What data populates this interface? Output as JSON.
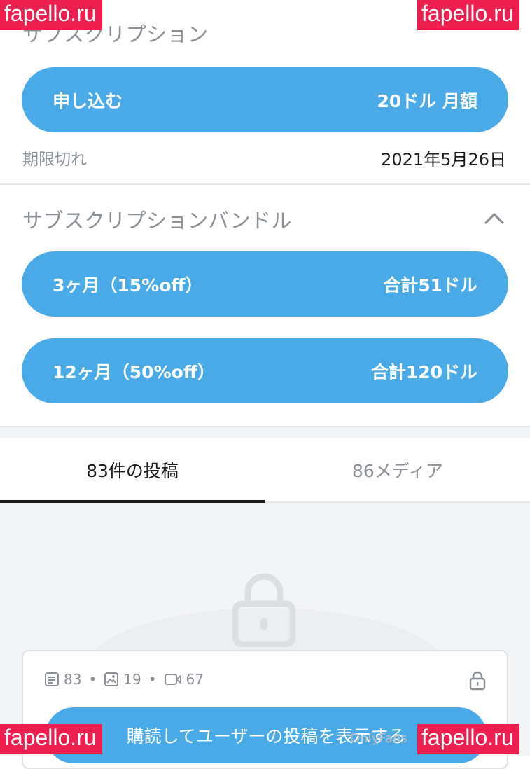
{
  "subscription": {
    "title": "サブスクリプション",
    "subscribe_label": "申し込む",
    "price_label": "20ドル 月額",
    "expiry_label": "期限切れ",
    "expiry_date": "2021年5月26日"
  },
  "bundles": {
    "title": "サブスクリプションバンドル",
    "items": [
      {
        "period": "3ヶ月（15%off）",
        "total": "合計51ドル"
      },
      {
        "period": "12ヶ月（50%off）",
        "total": "合計120ドル"
      }
    ]
  },
  "tabs": [
    {
      "label": "83件の投稿",
      "active": true
    },
    {
      "label": "86メディア",
      "active": false
    }
  ],
  "locked_card": {
    "posts_count": "83",
    "images_count": "19",
    "videos_count": "67",
    "subscribe_cta": "購読してユーザーの投稿を表示する"
  },
  "brand_text": "OnlyFans",
  "watermark_text": "fapello.ru",
  "colors": {
    "accent": "#4aaae8",
    "watermark": "#ec1f4e",
    "muted_text": "#8a9096"
  }
}
